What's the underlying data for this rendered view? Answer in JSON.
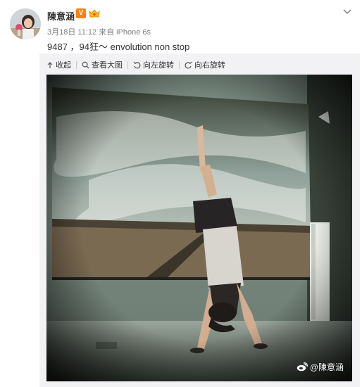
{
  "post": {
    "username": "陳意涵",
    "vip_badge": "V",
    "meta": {
      "date": "3月18日 11:12",
      "via_prefix": "来自",
      "source": "iPhone 6s"
    },
    "text": "9487 ，94狂～ envolution non stop"
  },
  "toolbar": {
    "collapse_label": "收起",
    "view_large_label": "查看大图",
    "rotate_left_label": "向左旋转",
    "rotate_right_label": "向右旋转"
  },
  "photo": {
    "alt": "handstand in front of landscape print",
    "watermark": "@陳意涵"
  },
  "colors": {
    "accent": "#ff8200",
    "meta_text": "#808080",
    "media_bg": "#f2f2f5"
  },
  "icons": [
    "chevron-down-icon",
    "collapse-arrow-icon",
    "magnifier-icon",
    "rotate-left-icon",
    "rotate-right-icon",
    "weibo-logo-icon",
    "crown-badge-icon"
  ]
}
